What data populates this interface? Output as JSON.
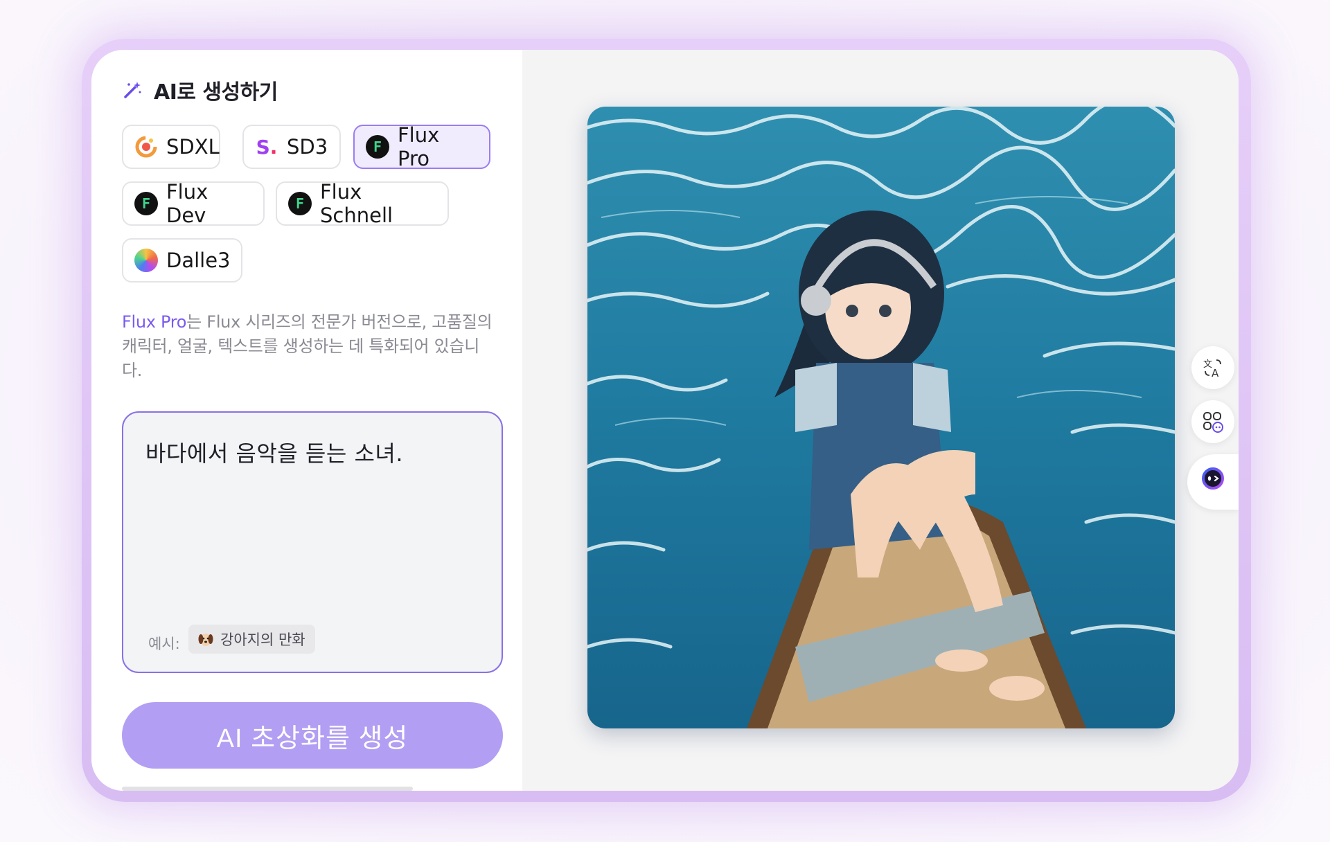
{
  "header": {
    "title": "AI로 생성하기",
    "icon": "magic-wand-icon"
  },
  "models": [
    {
      "label": "SDXL",
      "icon": "sdxl-logo-icon",
      "selected": false
    },
    {
      "label": "SD3",
      "icon": "sd3-logo-icon",
      "selected": false
    },
    {
      "label": "Flux Pro",
      "icon": "flux-logo-icon",
      "selected": true
    },
    {
      "label": "Flux Dev",
      "icon": "flux-logo-icon",
      "selected": false
    },
    {
      "label": "Flux Schnell",
      "icon": "flux-logo-icon",
      "selected": false
    },
    {
      "label": "Dalle3",
      "icon": "dalle-logo-icon",
      "selected": false
    }
  ],
  "sd3_logo_text": "S.",
  "description": {
    "highlight": "Flux Pro",
    "text": "는 Flux 시리즈의 전문가 버전으로, 고품질의 캐릭터, 얼굴, 텍스트를 생성하는 데 특화되어 있습니다."
  },
  "prompt": {
    "value": "바다에서 음악을 듣는 소녀.",
    "example_label": "예시:",
    "example_chip": "강아지의 만화",
    "example_icon": "dog-emoji-icon"
  },
  "generate_button": "AI 초상화를 생성",
  "side_buttons": [
    {
      "icon": "translate-icon"
    },
    {
      "icon": "apps-icon"
    },
    {
      "icon": "assistant-face-icon"
    }
  ],
  "colors": {
    "accent": "#7a5af0",
    "selected_border": "#9b7cf2",
    "button_bg": "#b29ef2",
    "prompt_border": "#8a70e6"
  }
}
